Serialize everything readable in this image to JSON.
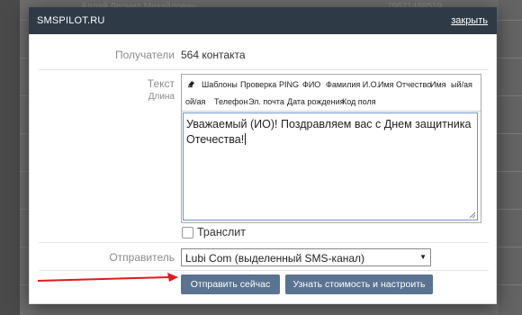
{
  "background": {
    "text_1": "Адлай Леонид Михайлович",
    "text_2": "79671488519"
  },
  "modal": {
    "title": "SMSPILOT.RU",
    "close_label": "закрыть",
    "recipients": {
      "label": "Получатели",
      "value": "564 контакта"
    },
    "text": {
      "label": "Текст",
      "length_label": "Длина",
      "toolbar": {
        "eraser_icon": "eraser-icon",
        "items_row1": [
          "Шаблоны",
          "Проверка",
          "PING",
          "ФИО",
          "Фамилия И.О.",
          "Имя Отчество",
          "Имя",
          "ый/ая"
        ],
        "items_row2": [
          "ой/ая",
          "Телефон",
          "Эл. почта",
          "Дата рождения",
          "Код поля"
        ]
      },
      "content_line1": "Уважаемый (ИО)! Поздравляем вас с Днем защитника",
      "content_line2": "Отечества!"
    },
    "translit_label": "Транслит",
    "translit_checked": false,
    "sender": {
      "label": "Отправитель",
      "value": "Lubi    Com (выделенный SMS-канал)"
    },
    "buttons": {
      "send_now": "Отправить сейчас",
      "cost_settings": "Узнать стоимость и настроить"
    }
  },
  "colors": {
    "header_bg": "#2e3b47",
    "button_bg": "#5a7391",
    "arrow": "#e0191b"
  }
}
